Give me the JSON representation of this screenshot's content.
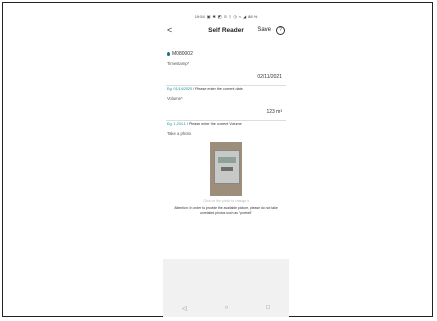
{
  "status_bar": {
    "time": "19:54",
    "icons": [
      "sim-icon",
      "settings-icon",
      "photo-icon",
      "lock-icon",
      "bluetooth-icon",
      "alarm-icon",
      "wifi-icon",
      "signal-icon"
    ],
    "battery": "88 %"
  },
  "app_bar": {
    "back": "<",
    "title": "Self Reader",
    "save_label": "Save",
    "help": "?"
  },
  "meter": {
    "icon": "water-drop-icon",
    "id": "M080002"
  },
  "timestamp": {
    "label": "Timestamp*",
    "value": "02/11/2021",
    "hint_example": "Eg. 01/14/2020",
    "hint_text": " / Please enter the current date."
  },
  "volume": {
    "label": "Volume*",
    "value": "123 m³",
    "hint_example": "Eg. 1,234.1",
    "hint_text": " / Please enter the current Volume"
  },
  "photo": {
    "label": "Take a photo",
    "caption": "Click on the photo to change it",
    "attention": "Attention: In order to provide the available picture, please do not take unrelated photos such as \"portrait\""
  },
  "nav_bar": {
    "back": "◁",
    "home": "○",
    "recent": "□"
  },
  "colors": {
    "accent": "#0f8f8f",
    "drop": "#1f6f8b"
  }
}
